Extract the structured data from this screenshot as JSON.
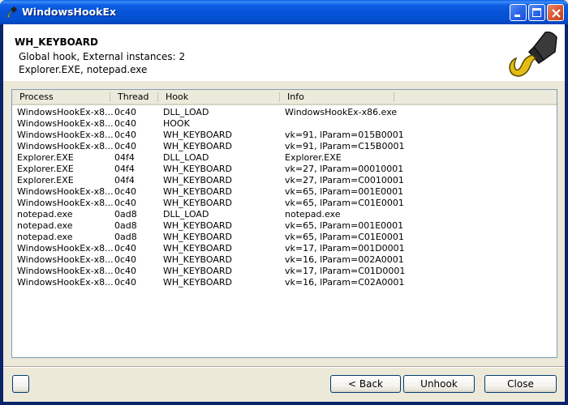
{
  "window": {
    "title": "WindowsHookEx",
    "controls": {
      "minimize": "minimize",
      "maximize": "maximize",
      "close": "close"
    }
  },
  "header": {
    "title": "WH_KEYBOARD",
    "subtitle_line1": "Global hook, External instances: 2",
    "subtitle_line2": "Explorer.EXE, notepad.exe",
    "logo_icon": "hook-icon"
  },
  "list": {
    "columns": [
      "Process",
      "Thread",
      "Hook",
      "Info"
    ],
    "rows": [
      [
        "WindowsHookEx-x8...",
        "0c40",
        "DLL_LOAD",
        "WindowsHookEx-x86.exe"
      ],
      [
        "WindowsHookEx-x8...",
        "0c40",
        "HOOK",
        ""
      ],
      [
        "WindowsHookEx-x8...",
        "0c40",
        "WH_KEYBOARD",
        "vk=91, lParam=015B0001"
      ],
      [
        "WindowsHookEx-x8...",
        "0c40",
        "WH_KEYBOARD",
        "vk=91, lParam=C15B0001"
      ],
      [
        "Explorer.EXE",
        "04f4",
        "DLL_LOAD",
        "Explorer.EXE"
      ],
      [
        "Explorer.EXE",
        "04f4",
        "WH_KEYBOARD",
        "vk=27, lParam=00010001"
      ],
      [
        "Explorer.EXE",
        "04f4",
        "WH_KEYBOARD",
        "vk=27, lParam=C0010001"
      ],
      [
        "WindowsHookEx-x8...",
        "0c40",
        "WH_KEYBOARD",
        "vk=65, lParam=001E0001"
      ],
      [
        "WindowsHookEx-x8...",
        "0c40",
        "WH_KEYBOARD",
        "vk=65, lParam=C01E0001"
      ],
      [
        "notepad.exe",
        "0ad8",
        "DLL_LOAD",
        "notepad.exe"
      ],
      [
        "notepad.exe",
        "0ad8",
        "WH_KEYBOARD",
        "vk=65, lParam=001E0001"
      ],
      [
        "notepad.exe",
        "0ad8",
        "WH_KEYBOARD",
        "vk=65, lParam=C01E0001"
      ],
      [
        "WindowsHookEx-x8...",
        "0c40",
        "WH_KEYBOARD",
        "vk=17, lParam=001D0001"
      ],
      [
        "WindowsHookEx-x8...",
        "0c40",
        "WH_KEYBOARD",
        "vk=16, lParam=002A0001"
      ],
      [
        "WindowsHookEx-x8...",
        "0c40",
        "WH_KEYBOARD",
        "vk=17, lParam=C01D0001"
      ],
      [
        "WindowsHookEx-x8...",
        "0c40",
        "WH_KEYBOARD",
        "vk=16, lParam=C02A0001"
      ]
    ]
  },
  "buttons": {
    "small": "",
    "back": "< Back",
    "unhook": "Unhook",
    "close": "Close"
  },
  "colors": {
    "titlebar": "#0553d8",
    "close_button": "#d85a35",
    "dialog_bg": "#ece9d8",
    "list_border": "#7f9db9",
    "button_border": "#003c74"
  }
}
